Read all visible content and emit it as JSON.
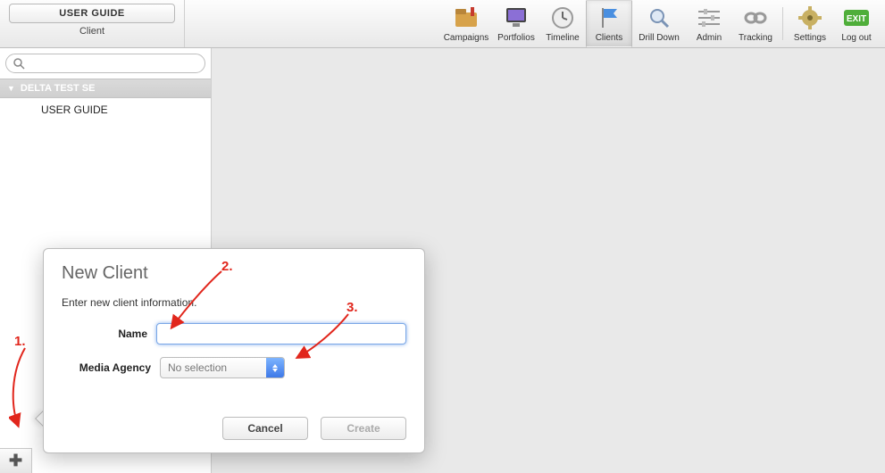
{
  "header": {
    "user_guide_btn": "USER GUIDE",
    "client_sub": "Client"
  },
  "toolbar": {
    "items": [
      {
        "id": "campaigns",
        "label": "Campaigns",
        "active": false
      },
      {
        "id": "portfolios",
        "label": "Portfolios",
        "active": false
      },
      {
        "id": "timeline",
        "label": "Timeline",
        "active": false
      },
      {
        "id": "clients",
        "label": "Clients",
        "active": true
      },
      {
        "id": "drilldown",
        "label": "Drill Down",
        "active": false
      },
      {
        "id": "admin",
        "label": "Admin",
        "active": false
      },
      {
        "id": "tracking",
        "label": "Tracking",
        "active": false
      }
    ],
    "right_items": [
      {
        "id": "settings",
        "label": "Settings"
      },
      {
        "id": "logout",
        "label": "Log out"
      }
    ]
  },
  "sidebar": {
    "search_placeholder": "",
    "group_label": "DELTA TEST SE",
    "tree_item": "USER GUIDE",
    "add_btn_glyph": "✚"
  },
  "dialog": {
    "title": "New Client",
    "subtitle": "Enter new client information.",
    "name_label": "Name",
    "name_value": "",
    "agency_label": "Media Agency",
    "agency_selected": "No selection",
    "cancel_label": "Cancel",
    "create_label": "Create"
  },
  "annotations": {
    "a1": "1.",
    "a2": "2.",
    "a3": "3."
  }
}
